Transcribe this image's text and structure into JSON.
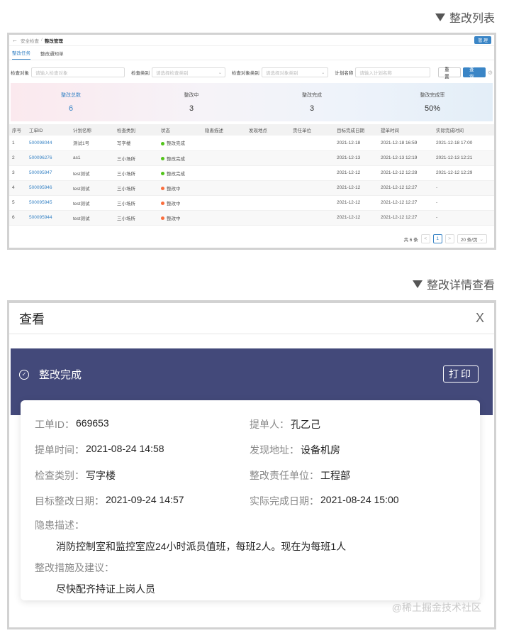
{
  "headings": {
    "list": "整改列表",
    "detail": "整改详情查看"
  },
  "list_panel": {
    "breadcrumb": {
      "parent": "安全检查",
      "current": "整改管理"
    },
    "admin_button": "管 理",
    "tabs": [
      {
        "label": "整改任务",
        "active": true
      },
      {
        "label": "整改通知单",
        "active": false
      }
    ],
    "filters": {
      "inspect_object": {
        "label": "检查对象",
        "placeholder": "请输入检查对象"
      },
      "inspect_type": {
        "label": "检查类别",
        "placeholder": "请选择检查类别"
      },
      "object_type": {
        "label": "检查对象类别",
        "placeholder": "请选择对象类别"
      },
      "plan_name": {
        "label": "计划名称",
        "placeholder": "请输入计划名称"
      },
      "reset": "重 置",
      "search": "查 询"
    },
    "stats": [
      {
        "label": "整改总数",
        "value": "6"
      },
      {
        "label": "整改中",
        "value": "3"
      },
      {
        "label": "整改完成",
        "value": "3"
      },
      {
        "label": "整改完成率",
        "value": "50%"
      }
    ],
    "columns": [
      "序号",
      "工单ID",
      "计划名称",
      "检查类别",
      "状态",
      "隐患描述",
      "发现地点",
      "责任单位",
      "目标完成日期",
      "提单时间",
      "实际完成时间"
    ],
    "rows": [
      {
        "no": "1",
        "id": "500098044",
        "plan": "测试1号",
        "type": "写字楼",
        "status": "整改完成",
        "status_color": "#52c41a",
        "desc": "",
        "place": "",
        "unit": "",
        "target": "2021-12-18",
        "submit": "2021-12-18 16:59",
        "done": "2021-12-18 17:00"
      },
      {
        "no": "2",
        "id": "500096276",
        "plan": "as1",
        "type": "三小场所",
        "status": "整改完成",
        "status_color": "#52c41a",
        "desc": "",
        "place": "",
        "unit": "",
        "target": "2021-12-13",
        "submit": "2021-12-13 12:19",
        "done": "2021-12-13 12:21"
      },
      {
        "no": "3",
        "id": "500095947",
        "plan": "test测试",
        "type": "三小场所",
        "status": "整改完成",
        "status_color": "#52c41a",
        "desc": "",
        "place": "",
        "unit": "",
        "target": "2021-12-12",
        "submit": "2021-12-12 12:28",
        "done": "2021-12-12 12:29"
      },
      {
        "no": "4",
        "id": "500095946",
        "plan": "test测试",
        "type": "三小场所",
        "status": "整改中",
        "status_color": "#fa6d3c",
        "desc": "",
        "place": "",
        "unit": "",
        "target": "2021-12-12",
        "submit": "2021-12-12 12:27",
        "done": "-"
      },
      {
        "no": "5",
        "id": "500095945",
        "plan": "test测试",
        "type": "三小场所",
        "status": "整改中",
        "status_color": "#fa6d3c",
        "desc": "",
        "place": "",
        "unit": "",
        "target": "2021-12-12",
        "submit": "2021-12-12 12:27",
        "done": "-"
      },
      {
        "no": "6",
        "id": "500095944",
        "plan": "test测试",
        "type": "三小场所",
        "status": "整改中",
        "status_color": "#fa6d3c",
        "desc": "",
        "place": "",
        "unit": "",
        "target": "2021-12-12",
        "submit": "2021-12-12 12:27",
        "done": "-"
      }
    ],
    "pager": {
      "total": "共 6 条",
      "prev": "<",
      "page": "1",
      "next": ">",
      "size": "20 条/页"
    }
  },
  "detail_panel": {
    "title": "查看",
    "close": "X",
    "status": "整改完成",
    "print": "打印",
    "fields": [
      {
        "key": "工单ID：",
        "value": "669653"
      },
      {
        "key": "提单人：",
        "value": "孔乙己"
      },
      {
        "key": "提单时间：",
        "value": "2021-08-24 14:58"
      },
      {
        "key": "发现地址：",
        "value": "设备机房"
      },
      {
        "key": "检查类别：",
        "value": "写字楼"
      },
      {
        "key": "整改责任单位：",
        "value": "工程部"
      },
      {
        "key": "目标整改日期：",
        "value": "2021-09-24 14:57"
      },
      {
        "key": "实际完成日期：",
        "value": "2021-08-24 15:00"
      }
    ],
    "hazard_label": "隐患描述：",
    "hazard_text": "消防控制室和监控室应24小时派员值班，每班2人。现在为每班1人",
    "measure_label": "整改措施及建议：",
    "measure_text": "尽快配齐持证上岗人员",
    "watermark": "@稀土掘金技术社区"
  },
  "colors": {
    "accent": "#3a85c6",
    "band": "#43497a",
    "done": "#52c41a",
    "in_progress": "#fa6d3c"
  }
}
